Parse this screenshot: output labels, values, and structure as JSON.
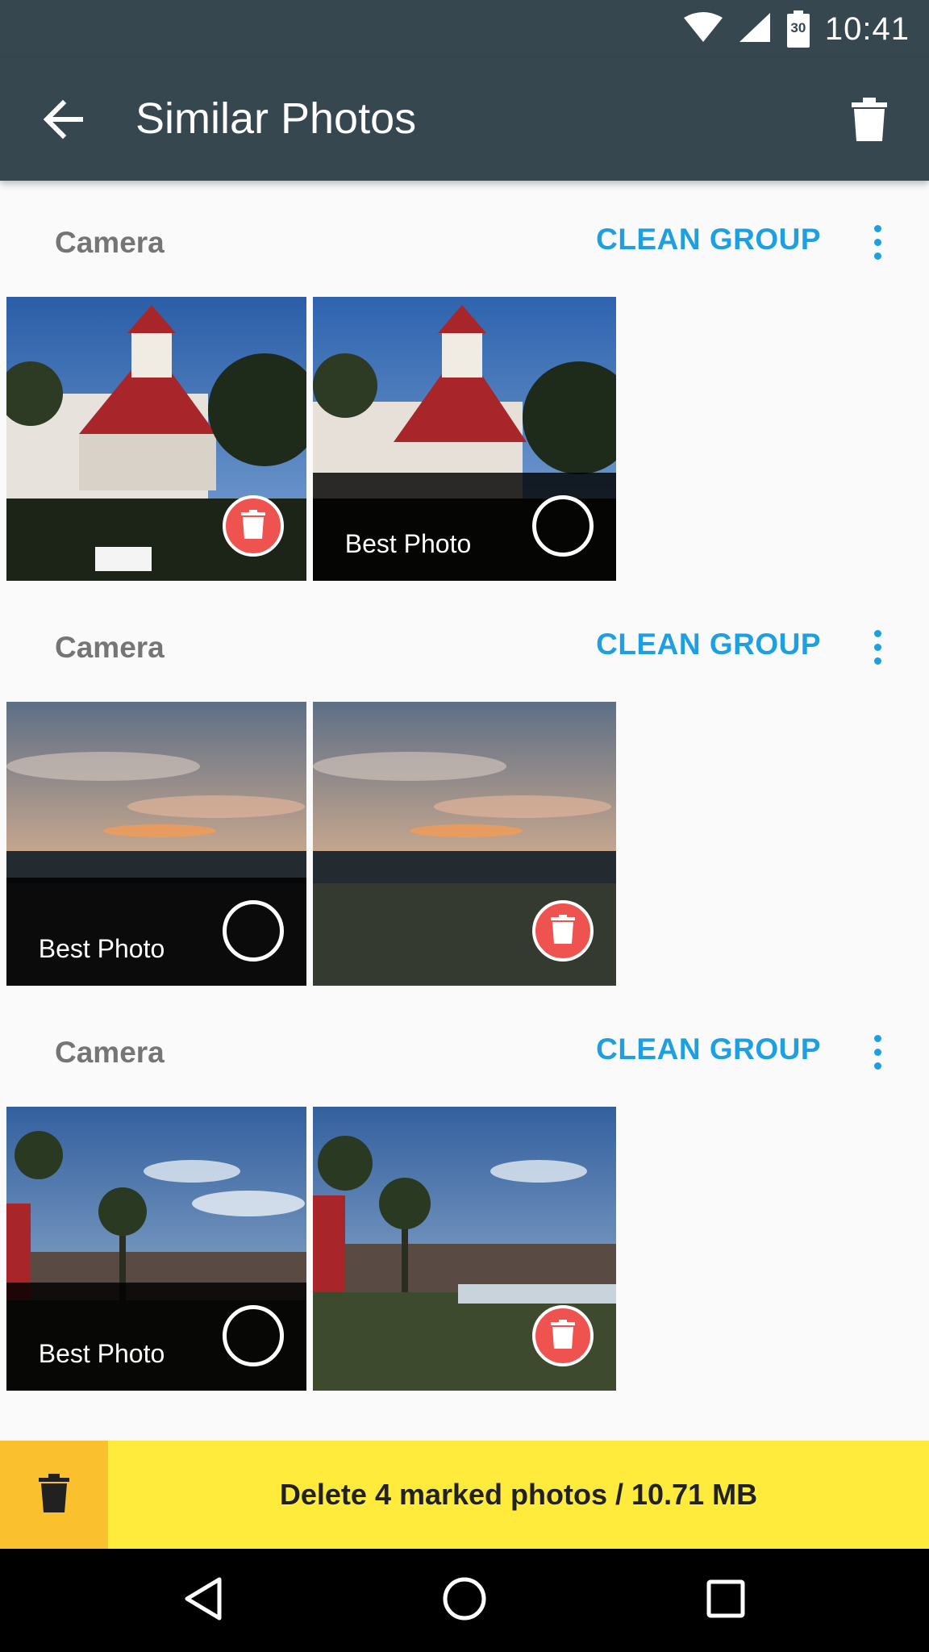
{
  "status_bar": {
    "time": "10:41",
    "battery_level": "30",
    "icons": [
      "wifi-icon",
      "signal-icon",
      "battery-icon"
    ]
  },
  "app_bar": {
    "title": "Similar Photos",
    "back_icon": "arrow-back-icon",
    "action_icon": "trash-icon"
  },
  "groups": [
    {
      "title": "Camera",
      "clean_label": "CLEAN GROUP",
      "photos": [
        {
          "best": false,
          "marked": true
        },
        {
          "best": true,
          "best_label": "Best Photo",
          "marked": false
        }
      ]
    },
    {
      "title": "Camera",
      "clean_label": "CLEAN GROUP",
      "photos": [
        {
          "best": true,
          "best_label": "Best Photo",
          "marked": false
        },
        {
          "best": false,
          "marked": true
        }
      ]
    },
    {
      "title": "Camera",
      "clean_label": "CLEAN GROUP",
      "photos": [
        {
          "best": true,
          "best_label": "Best Photo",
          "marked": false
        },
        {
          "best": false,
          "marked": true
        }
      ]
    }
  ],
  "bottom_action": {
    "label": "Delete 4 marked photos / 10.71 MB",
    "icon": "trash-icon"
  },
  "nav_bar": {
    "buttons": [
      "back-triangle-icon",
      "home-circle-icon",
      "recents-square-icon"
    ]
  },
  "colors": {
    "app_bar": "#37474f",
    "accent": "#1e9fe0",
    "delete_red": "#ef5350",
    "bottom_bar": "#ffeb3b",
    "bottom_icon_bg": "#fbc02d"
  }
}
